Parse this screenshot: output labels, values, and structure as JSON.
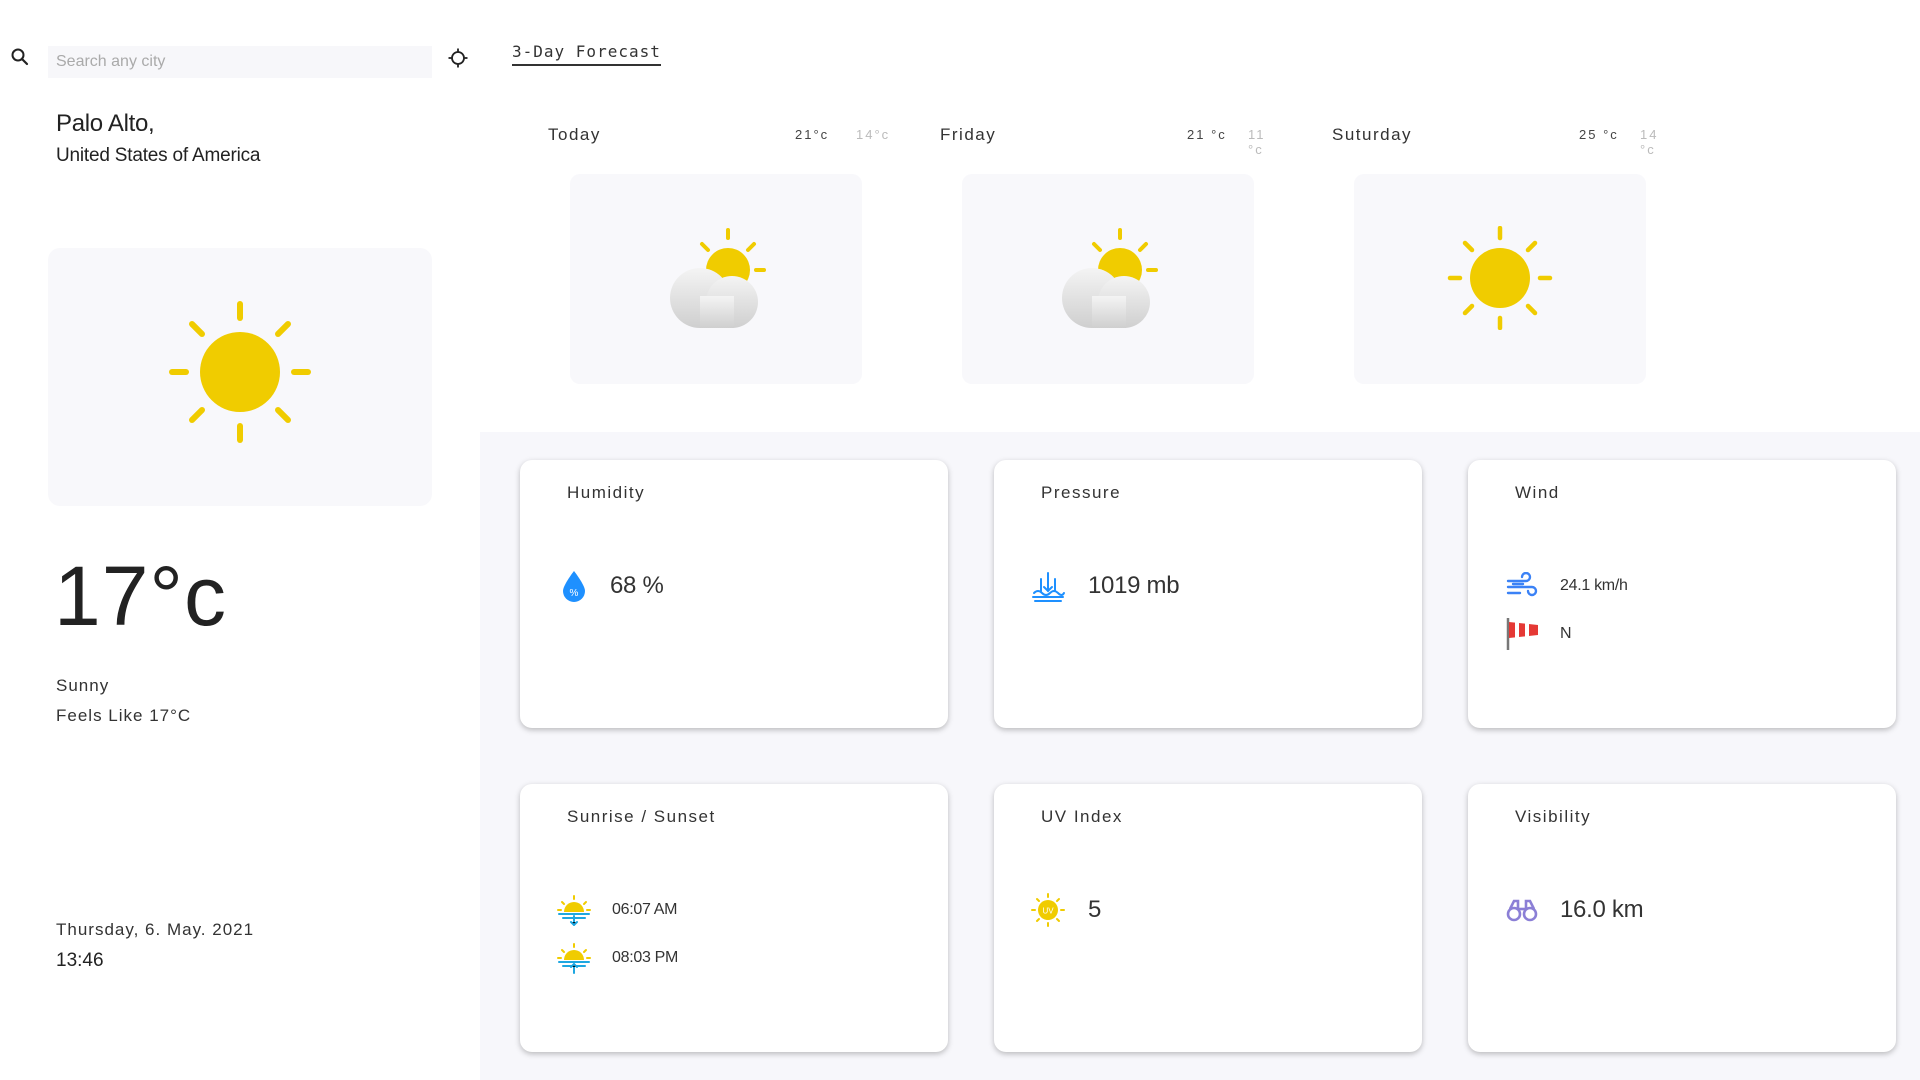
{
  "search": {
    "placeholder": "Search any city"
  },
  "location": {
    "city": "Palo Alto,",
    "country": "United States of America"
  },
  "current": {
    "icon": "sun-icon",
    "temperature": "17°c",
    "condition": "Sunny",
    "feels_like": "Feels Like 17°C",
    "date": "Thursday, 6. May. 2021",
    "time": "13:46"
  },
  "forecast": {
    "tab_label": "3-Day Forecast",
    "days": [
      {
        "name": "Today",
        "high": "21°c",
        "low": "14°c",
        "icon": "partly-cloudy-icon"
      },
      {
        "name": "Friday",
        "high": "21 °c",
        "low": "11 °c",
        "icon": "partly-cloudy-icon"
      },
      {
        "name": "Suturday",
        "high": "25 °c",
        "low": "14 °c",
        "icon": "sun-icon"
      }
    ]
  },
  "highlights": {
    "humidity": {
      "title": "Humidity",
      "value": "68 %"
    },
    "pressure": {
      "title": "Pressure",
      "value": "1019 mb"
    },
    "wind": {
      "title": "Wind",
      "speed": "24.1 km/h",
      "direction": "N"
    },
    "sun": {
      "title": "Sunrise / Sunset",
      "sunrise": "06:07 AM",
      "sunset": "08:03 PM"
    },
    "uv": {
      "title": "UV Index",
      "value": "5"
    },
    "visibility": {
      "title": "Visibility",
      "value": "16.0 km"
    }
  },
  "colors": {
    "sun": "#F0CC00",
    "card_bg": "#F8F8FB",
    "panel_bg": "#F7F7FB",
    "water": "#1E90FF",
    "wind_blue": "#3B82F6",
    "windsock_red": "#E53935",
    "binoculars": "#8B7FD6"
  }
}
